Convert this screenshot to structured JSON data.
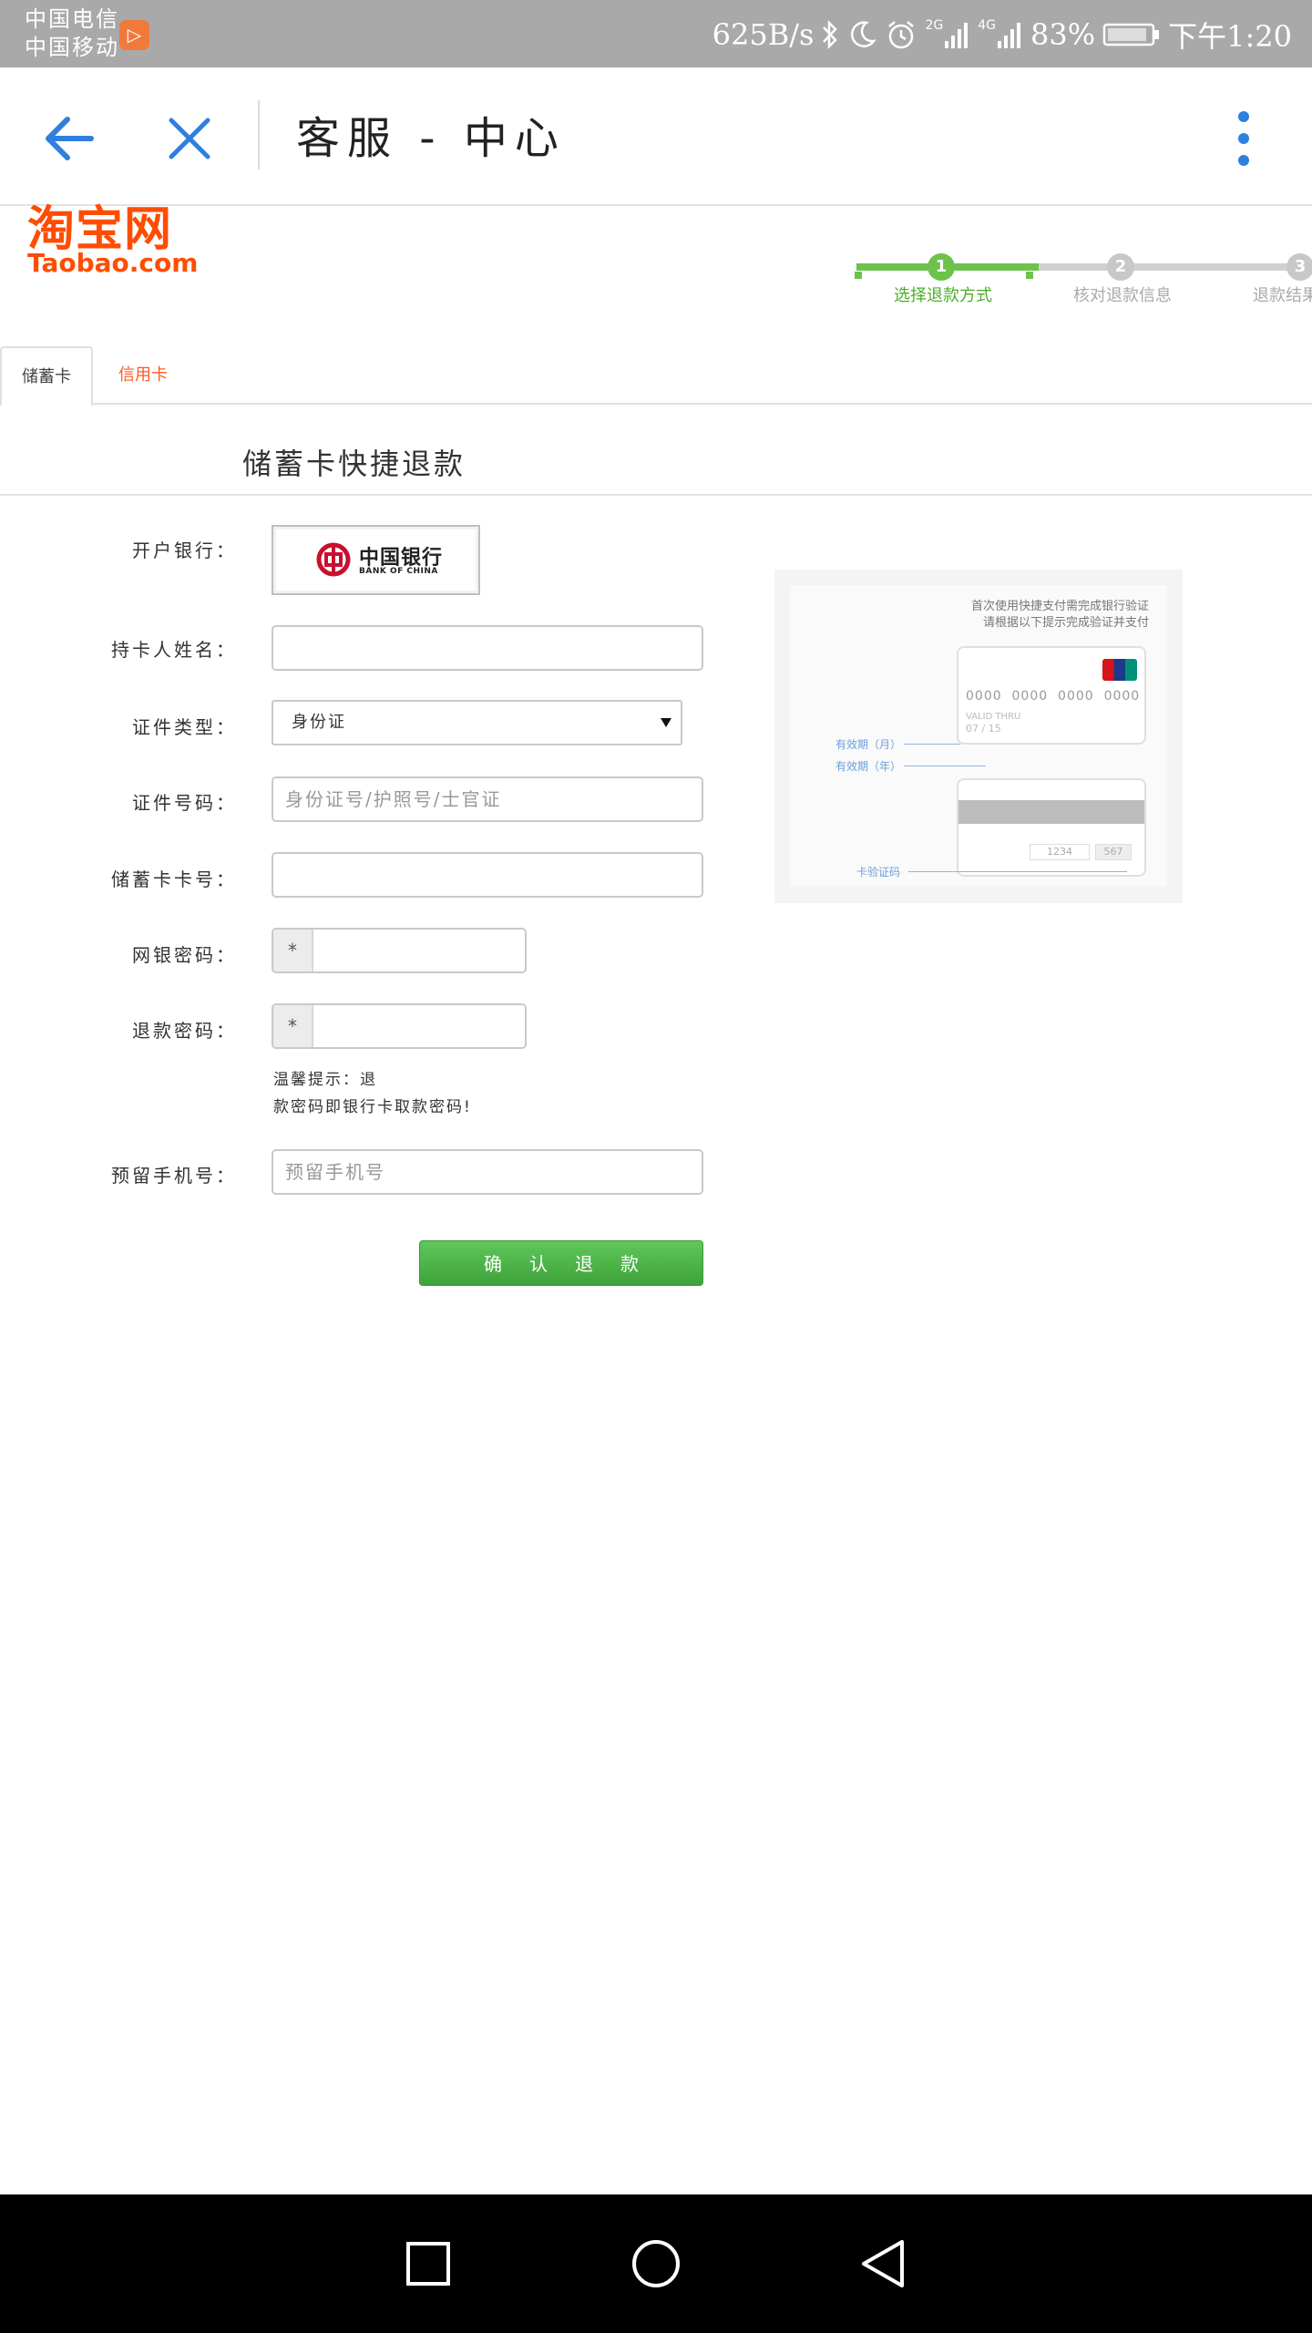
{
  "status_bar": {
    "carrier_1": "中国电信",
    "carrier_2": "中国移动",
    "net_speed": "625B/s",
    "signal_1": "2G",
    "signal_2": "4G",
    "battery": "83%",
    "time": "下午1:20"
  },
  "app_bar": {
    "title": "客服 - 中心"
  },
  "logo": {
    "cn": "淘宝网",
    "en": "Taobao.com"
  },
  "steps": [
    {
      "number": "1",
      "label": "选择退款方式"
    },
    {
      "number": "2",
      "label": "核对退款信息"
    },
    {
      "number": "3",
      "label": "退款结果"
    }
  ],
  "tabs": {
    "debit": "储蓄卡",
    "credit": "信用卡"
  },
  "section_title": "储蓄卡快捷退款",
  "form": {
    "bank_label": "开户银行：",
    "bank_name_cn": "中国银行",
    "bank_name_en": "BANK OF CHINA",
    "holder_label": "持卡人姓名：",
    "holder_value": "",
    "id_type_label": "证件类型：",
    "id_type_value": "身份证",
    "id_number_label": "证件号码：",
    "id_number_placeholder": "身份证号/护照号/士官证",
    "card_number_label": "储蓄卡卡号：",
    "card_number_value": "",
    "netbank_pw_label": "网银密码：",
    "netbank_pw_prefix": "*",
    "refund_pw_label": "退款密码：",
    "refund_pw_prefix": "*",
    "hint_line_1": "温馨提示：退",
    "hint_line_2": "款密码即银行卡取款密码!",
    "phone_label": "预留手机号：",
    "phone_placeholder": "预留手机号",
    "submit": "确认退款"
  },
  "illustration": {
    "note_line_1": "首次使用快捷支付需完成银行验证",
    "note_line_2": "请根据以下提示完成验证并支付",
    "card_digits": "0000  0000  0000  0000",
    "valid_thru": "VALID THRU",
    "expiry": "07 / 15",
    "month_label": "有效期（月）",
    "year_label": "有效期（年）",
    "sig_number": "1234",
    "cvv": "567",
    "cvv_label": "卡验证码"
  },
  "colors": {
    "status_bar": "#a9a9a9",
    "accent_blue": "#2f7fdd",
    "taobao_orange": "#ff4d00",
    "step_active": "#6cc24a",
    "step_inactive": "#c8c8c8",
    "button_green": "#4cb648"
  }
}
